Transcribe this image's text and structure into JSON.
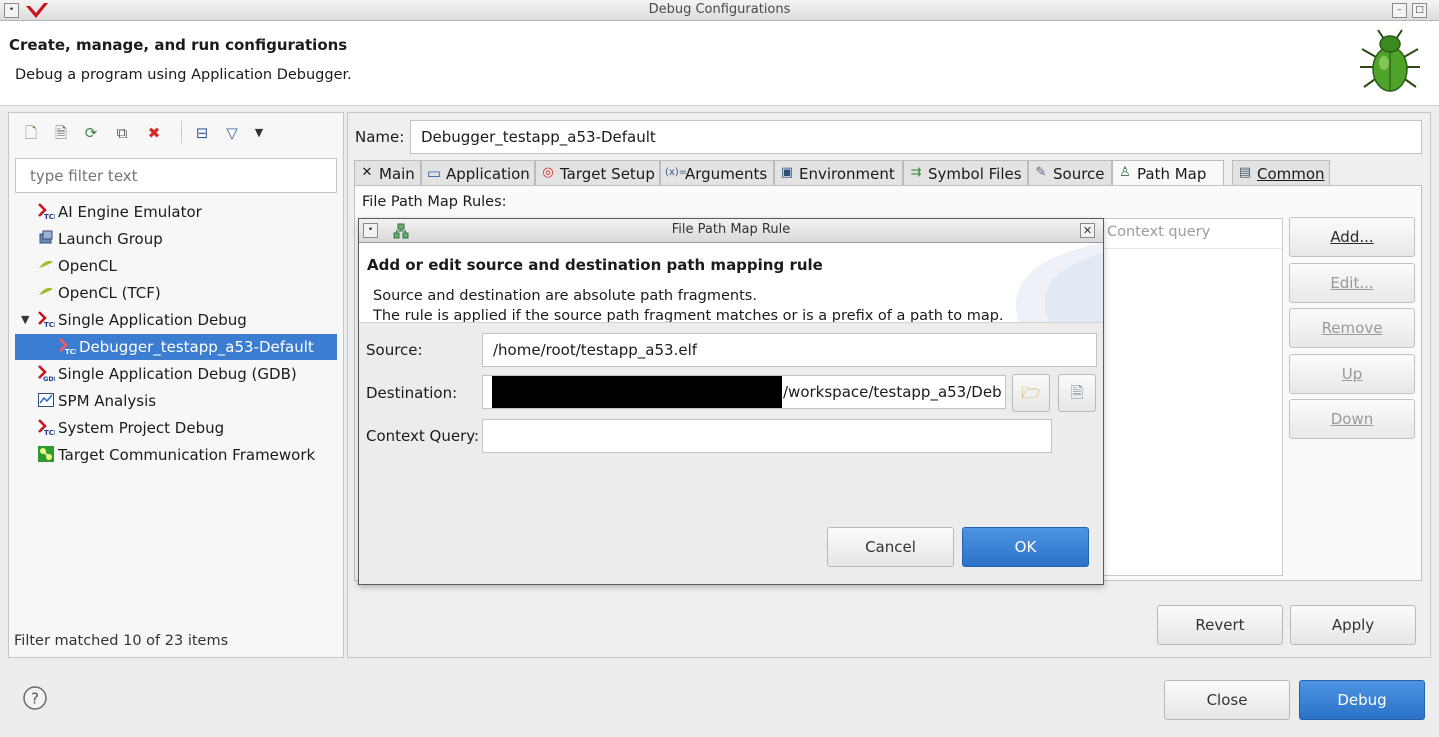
{
  "window": {
    "title": "Debug Configurations"
  },
  "header": {
    "title": "Create, manage, and run configurations",
    "subtitle": "Debug a program using Application Debugger."
  },
  "left": {
    "filter_placeholder": "type filter text",
    "tree": [
      {
        "label": "AI Engine Emulator",
        "icon": "tcf-x-icon"
      },
      {
        "label": "Launch Group",
        "icon": "launch-group-icon"
      },
      {
        "label": "OpenCL",
        "icon": "opencl-icon"
      },
      {
        "label": "OpenCL (TCF)",
        "icon": "opencl-icon"
      },
      {
        "label": "Single Application Debug",
        "icon": "tcf-x-icon"
      },
      {
        "label": "Debugger_testapp_a53-Default",
        "icon": "tcf-x-icon"
      },
      {
        "label": "Single Application Debug (GDB)",
        "icon": "gdb-x-icon"
      },
      {
        "label": "SPM Analysis",
        "icon": "chart-icon"
      },
      {
        "label": "System Project Debug",
        "icon": "tcf-x-icon"
      },
      {
        "label": "Target Communication Framework",
        "icon": "tcf-green-icon"
      }
    ],
    "status": "Filter matched 10 of 23 items"
  },
  "right": {
    "name_label": "Name:",
    "name_value": "Debugger_testapp_a53-Default",
    "tabs": [
      "Main",
      "Application",
      "Target Setup",
      "Arguments",
      "Environment",
      "Symbol Files",
      "Source",
      "Path Map",
      "Common"
    ],
    "active_tab": "Path Map",
    "rules_label": "File Path Map Rules:",
    "table_columns": [
      "Context query"
    ],
    "buttons": {
      "add": "Add...",
      "edit": "Edit...",
      "remove": "Remove",
      "up": "Up",
      "down": "Down"
    },
    "revert": "Revert",
    "apply": "Apply"
  },
  "dialog": {
    "title": "File Path Map Rule",
    "heading": "Add or edit source and destination path mapping rule",
    "desc1": "Source and destination are absolute path fragments.",
    "desc2": "The rule is applied if the source path fragment matches or is a prefix of a path to map.",
    "source_label": "Source:",
    "source_value": "/home/root/testapp_a53.elf",
    "destination_label": "Destination:",
    "destination_value": "/workspace/testapp_a53/Deb",
    "context_label": "Context Query:",
    "context_value": "",
    "cancel": "Cancel",
    "ok": "OK"
  },
  "footer": {
    "close": "Close",
    "debug": "Debug"
  },
  "colors": {
    "accent": "#3b7dd1",
    "primary_button": "#2f76cb"
  }
}
